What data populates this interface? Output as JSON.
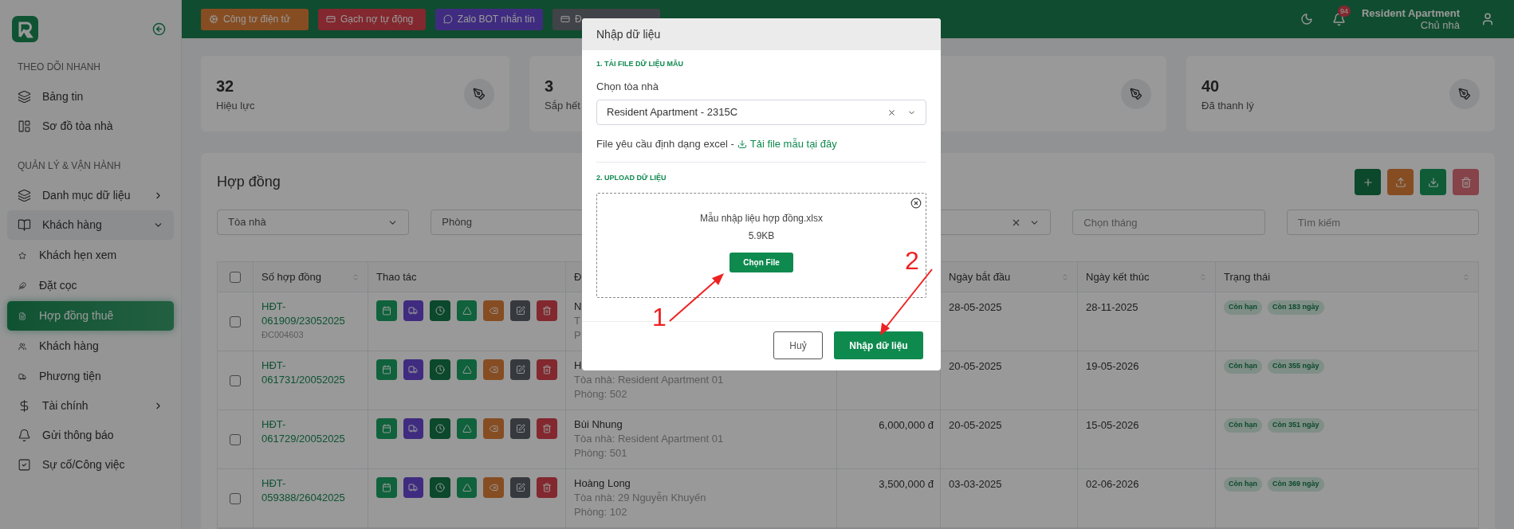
{
  "sidebar": {
    "sections": [
      {
        "title": "THEO DÕI NHANH",
        "items": [
          {
            "label": "Bảng tin",
            "selected": false
          },
          {
            "label": "Sơ đồ tòa nhà",
            "selected": false
          }
        ]
      },
      {
        "title": "QUẢN LÝ & VẬN HÀNH",
        "items": [
          {
            "label": "Danh mục dữ liệu",
            "expanded": false,
            "selected": false
          },
          {
            "label": "Khách hàng",
            "expanded": true,
            "selected": false,
            "children": [
              {
                "label": "Khách hẹn xem",
                "selected": false
              },
              {
                "label": "Đặt cọc",
                "selected": false
              },
              {
                "label": "Hợp đồng thuê",
                "selected": true
              },
              {
                "label": "Khách hàng",
                "selected": false
              },
              {
                "label": "Phương tiện",
                "selected": false
              }
            ]
          },
          {
            "label": "Tài chính",
            "expanded": false,
            "selected": false
          },
          {
            "label": "Gửi thông báo",
            "selected": false
          },
          {
            "label": "Sự cố/Công việc",
            "selected": false
          }
        ]
      }
    ]
  },
  "topbar": {
    "buttons": [
      {
        "label": "Công tơ điện tử"
      },
      {
        "label": "Gạch nợ tự động"
      },
      {
        "label": "Zalo BOT nhắn tin"
      },
      {
        "label": "Đ"
      }
    ],
    "notifications": "94",
    "user_name": "Resident Apartment",
    "user_role": "Chủ nhà"
  },
  "stats": [
    {
      "kind": "stat",
      "value": "32",
      "label": "Hiệu lực"
    },
    {
      "kind": "stat-cut",
      "value": "3",
      "label": "Sắp hết"
    },
    {
      "kind": "stat"
    },
    {
      "kind": "stat",
      "value": "40",
      "label": "Đã thanh lý"
    }
  ],
  "contracts": {
    "title": "Hợp đồng",
    "actions": [
      {
        "kind": "add"
      },
      {
        "kind": "upload"
      },
      {
        "kind": "download"
      },
      {
        "kind": "delete"
      }
    ],
    "filters": [
      {
        "kind": "select",
        "placeholder": "Tòa nhà",
        "clearable": false
      },
      {
        "kind": "select-cut",
        "placeholder": "Phòng"
      },
      {
        "kind": "select",
        "clearable": true
      },
      {
        "kind": "input",
        "placeholder": "Chọn tháng"
      },
      {
        "kind": "input",
        "placeholder": "Tìm kiếm"
      }
    ],
    "header_checked": false,
    "columns": [
      {
        "label": "Số hợp đồng",
        "sortable": true
      },
      {
        "label": "Thao tác",
        "sortable": false
      },
      {
        "label": "Đ"
      },
      {
        "label": "Ngày bắt đầu",
        "sortable": true
      },
      {
        "label": "Ngày kết thúc",
        "sortable": true
      },
      {
        "label": "Trạng thái",
        "sortable": true
      }
    ],
    "rows": [
      {
        "checked": false,
        "code": "HĐT-061909/23052025",
        "deposit": "ĐC004603",
        "name": "N",
        "building": "T",
        "room": "P",
        "start": "28-05-2025",
        "end": "28-11-2025",
        "tags": [
          "Còn hạn",
          "Còn 183 ngày"
        ]
      },
      {
        "checked": false,
        "code": "HĐT-061731/20052025",
        "name": "H",
        "building": "Tòa nhà: Resident Apartment 01",
        "room": "Phòng: 502",
        "start": "20-05-2025",
        "end": "19-05-2026",
        "tags": [
          "Còn hạn",
          "Còn 355 ngày"
        ]
      },
      {
        "checked": false,
        "code": "HĐT-061729/20052025",
        "name": "Bùi Nhung",
        "building": "Tòa nhà: Resident Apartment 01",
        "room": "Phòng: 501",
        "price": "6,000,000 đ",
        "start": "20-05-2025",
        "end": "15-05-2026",
        "tags": [
          "Còn hạn",
          "Còn 351 ngày"
        ]
      },
      {
        "checked": false,
        "code": "HĐT-059388/26042025",
        "name": "Hoàng Long",
        "building": "Tòa nhà: 29 Nguyễn Khuyến",
        "room": "Phòng: 102",
        "price": "3,500,000 đ",
        "start": "03-03-2025",
        "end": "02-06-2026",
        "tags": [
          "Còn hạn",
          "Còn 369 ngày"
        ]
      }
    ]
  },
  "modal": {
    "title": "Nhập dữ liệu",
    "section_1": "1. TẢI FILE DỮ LIỆU MẪU",
    "building_label": "Chọn tòa nhà",
    "building_value": "Resident Apartment - 2315C",
    "hint": "File yêu cầu định dạng excel -",
    "template_link": "Tải file mẫu tại đây",
    "section_2": "2. UPLOAD DỮ LIỆU",
    "file_name": "Mẫu nhập liệu hợp đồng.xlsx",
    "file_size": "5.9KB",
    "choose_button": "Chọn File",
    "cancel_button": "Huỷ",
    "submit_button": "Nhập dữ liệu"
  },
  "annotations": [
    {
      "label": "1"
    },
    {
      "label": "2"
    }
  ]
}
